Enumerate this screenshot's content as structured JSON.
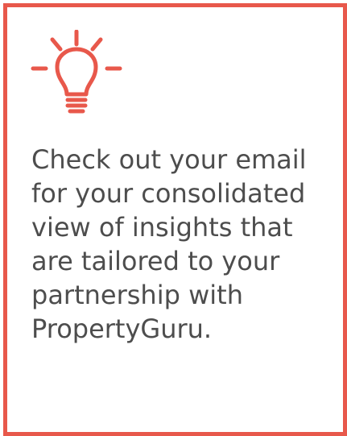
{
  "card": {
    "icon": "lightbulb-icon",
    "message": "Check out your email\nfor your consolidated\nview of insights that\nare tailored to your\npartnership with\nPropertyGuru.",
    "accent_color": "#e8584b",
    "text_color": "#4d4d4d"
  }
}
